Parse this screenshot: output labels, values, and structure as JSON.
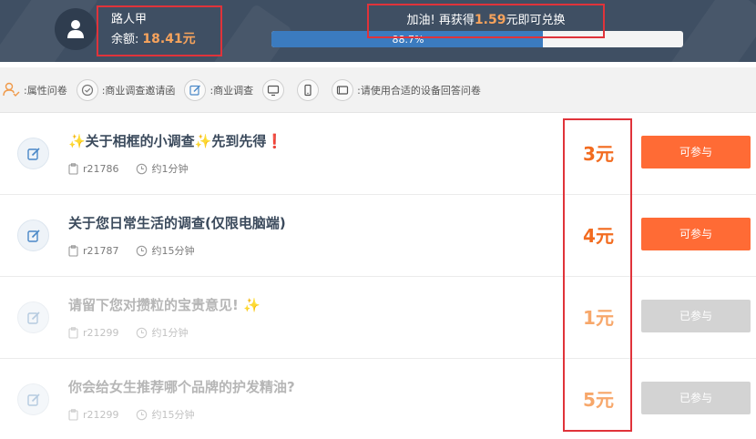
{
  "header": {
    "user_name": "路人甲",
    "balance_label": "余额:",
    "balance_amount": "18.41元",
    "goal_prefix": "加油! 再获得",
    "goal_amount": "1.59",
    "goal_suffix": "元即可兑换",
    "progress_text": "88.7%",
    "progress_value": 0.66
  },
  "legend": [
    {
      "icon": "person-icon",
      "label": ":属性问卷"
    },
    {
      "icon": "check-circle-icon",
      "label": ":商业调查邀请函"
    },
    {
      "icon": "edit-icon",
      "label": ":商业调查"
    },
    {
      "icon": "monitor-icon",
      "label": ""
    },
    {
      "icon": "phone-icon",
      "label": ""
    },
    {
      "icon": "tablet-icon",
      "label": ":请使用合适的设备回答问卷"
    }
  ],
  "surveys": [
    {
      "title": "✨关于相框的小调查✨先到先得❗",
      "id": "r21786",
      "duration": "约1分钟",
      "price": "3元",
      "button": "可参与",
      "done": false
    },
    {
      "title": "关于您日常生活的调查(仅限电脑端)",
      "id": "r21787",
      "duration": "约15分钟",
      "price": "4元",
      "button": "可参与",
      "done": false
    },
    {
      "title": "请留下您对攒粒的宝贵意见! ✨",
      "id": "r21299",
      "duration": "约1分钟",
      "price": "1元",
      "button": "已参与",
      "done": true
    },
    {
      "title": "你会给女生推荐哪个品牌的护发精油?",
      "id": "r21299",
      "duration": "约15分钟",
      "price": "5元",
      "button": "已参与",
      "done": true
    }
  ],
  "colors": {
    "header_bg": "#3f4f63",
    "accent_orange": "#ff6b35",
    "price_orange": "#f26b1f",
    "progress_blue": "#3b7bbf",
    "annotation_red": "#e0333a",
    "disabled_gray": "#d3d3d3"
  }
}
